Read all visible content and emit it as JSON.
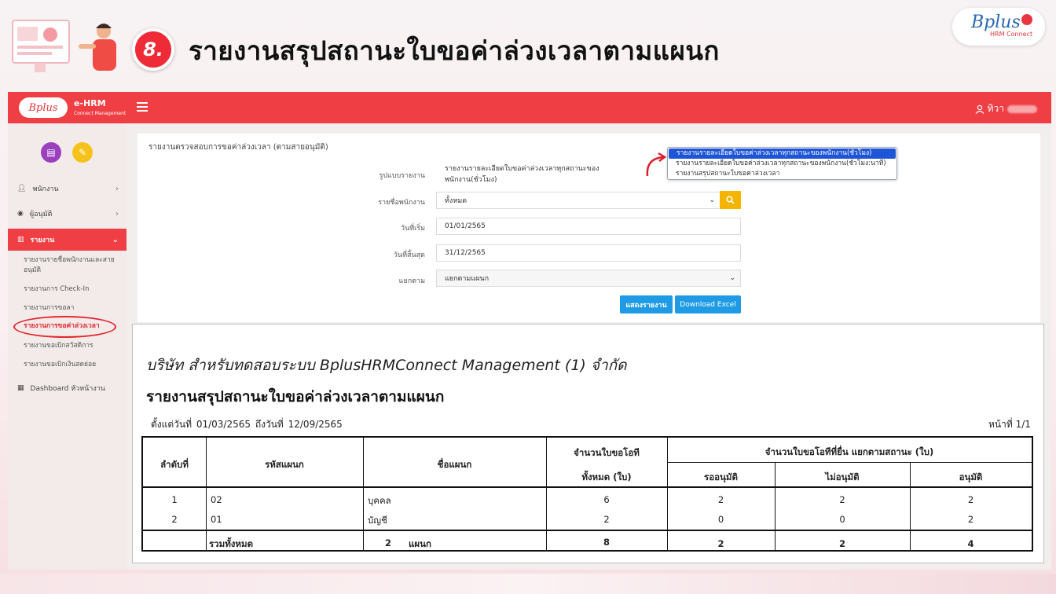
{
  "slide": {
    "number": "8.",
    "title": "รายงานสรุปสถานะใบขอค่าล่วงเวลาตามแผนก",
    "brand": "Bplus",
    "brand_sub": "HRM Connect"
  },
  "app": {
    "logo_text": "Bplus",
    "name": "e-HRM",
    "name_sub": "Connect Management",
    "user_label": "ทิวา"
  },
  "sidebar": {
    "items": [
      {
        "label": "พนักงาน"
      },
      {
        "label": "ผู้อนุมัติ"
      },
      {
        "label": "รายงาน"
      },
      {
        "label": "Dashboard หัวหน้างาน"
      }
    ],
    "sub_items": [
      {
        "label": "รายงานรายชื่อพนักงานและสายอนุมัติ"
      },
      {
        "label": "รายงานการ Check-In"
      },
      {
        "label": "รายงานการขอลา"
      },
      {
        "label": "รายงานการขอค่าล่วงเวลา"
      },
      {
        "label": "รายงานขอเบิกสวัสดิการ"
      },
      {
        "label": "รายงานขอเบิกเงินสดย่อย"
      }
    ]
  },
  "form": {
    "title": "รายงานตรวจสอบการขอค่าล่วงเวลา (ตามสายอนุมัติ)",
    "format_label": "รูปแบบรายงาน",
    "format_value": "รายงานรายละเอียดใบขอค่าล่วงเวลาทุกสถานะของพนักงาน(ชั่วโมง)",
    "employee_label": "รายชื่อพนักงาน",
    "employee_value": "ทั้งหมด",
    "start_label": "วันที่เริ่ม",
    "start_value": "01/01/2565",
    "end_label": "วันที่สิ้นสุด",
    "end_value": "31/12/2565",
    "split_label": "แยกตาม",
    "split_value": "แยกตามแผนก",
    "show_button": "แสดงรายงาน",
    "excel_button": "Download Excel",
    "dropdown_options": [
      "รายงานรายละเอียดใบขอค่าล่วงเวลาทุกสถานะของพนักงาน(ชั่วโมง)",
      "รายงานรายละเอียดใบขอค่าล่วงเวลาทุกสถานะของพนักงาน(ชั่วโมง:นาที)",
      "รายงานสรุปสถานะใบขอค่าล่วงเวลา"
    ]
  },
  "report": {
    "company": "บริษัท สำหรับทดสอบระบบ BplusHRMConnect Management (1) จำกัด",
    "title": "รายงานสรุปสถานะใบขอค่าล่วงเวลาตามแผนก",
    "date_range": "ตั้งแต่วันที่   01/03/2565   ถึงวันที่   12/09/2565",
    "page": "หน้าที่ 1/1",
    "headers": {
      "no": "ลำดับที่",
      "dept_code": "รหัสแผนก",
      "dept_name": "ชื่อแผนก",
      "total_line1": "จำนวนใบขอโอที",
      "total_line2": "ทั้งหมด (ใบ)",
      "status_group": "จำนวนใบขอโอทีที่ยื่น แยกตามสถานะ (ใบ)",
      "pending": "รออนุมัติ",
      "rejected": "ไม่อนุมัติ",
      "approved": "อนุมัติ"
    },
    "rows": [
      {
        "no": "1",
        "code": "02",
        "name": "บุคคล",
        "total": "6",
        "pending": "2",
        "rejected": "2",
        "approved": "2"
      },
      {
        "no": "2",
        "code": "01",
        "name": "บัญชี",
        "total": "2",
        "pending": "0",
        "rejected": "0",
        "approved": "2"
      }
    ],
    "summary": {
      "label": "รวมทั้งหมด",
      "dept_count": "2",
      "dept_unit": "แผนก",
      "total": "8",
      "pending": "2",
      "rejected": "2",
      "approved": "4"
    }
  }
}
